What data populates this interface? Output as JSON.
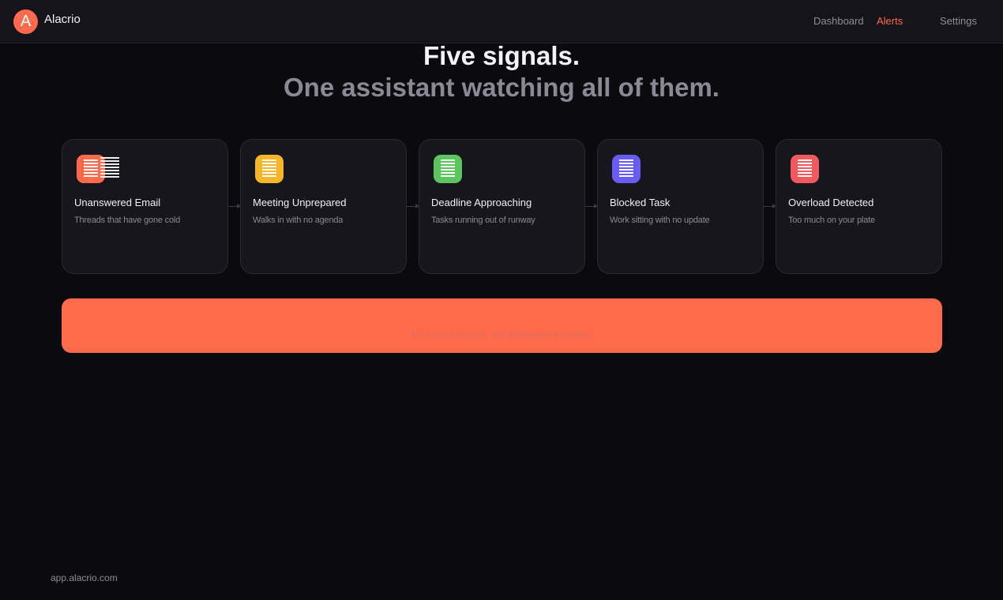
{
  "app": {
    "name": "Alacrio",
    "logo_letter": "A",
    "accent": "#ff6a4d"
  },
  "nav": {
    "items": [
      {
        "label": "Dashboard",
        "active": false
      },
      {
        "label": "Alerts",
        "active": true
      },
      {
        "label": "Settings",
        "active": false
      }
    ]
  },
  "hero": {
    "title": "Five signals.",
    "subtitle": "One assistant watching all of them."
  },
  "signals": [
    {
      "title": "Unanswered Email",
      "description": "Threads that have gone cold",
      "color": "#ff6a4d",
      "icon": "email-icon"
    },
    {
      "title": "Meeting Unprepared",
      "description": "Walks in with no agenda",
      "color": "#f6b62b",
      "icon": "meeting-icon"
    },
    {
      "title": "Deadline Approaching",
      "description": "Tasks running out of runway",
      "color": "#5cc55f",
      "icon": "deadline-icon"
    },
    {
      "title": "Blocked Task",
      "description": "Work sitting with no update",
      "color": "#6a5cf2",
      "icon": "blocked-icon"
    },
    {
      "title": "Overload Detected",
      "description": "Too much on your plate",
      "color": "#f05a5f",
      "icon": "overload-icon"
    }
  ],
  "banner": {
    "text": "No Bnand created. No dashboard to chase."
  },
  "footer": {
    "url": "app.alacrio.com"
  }
}
